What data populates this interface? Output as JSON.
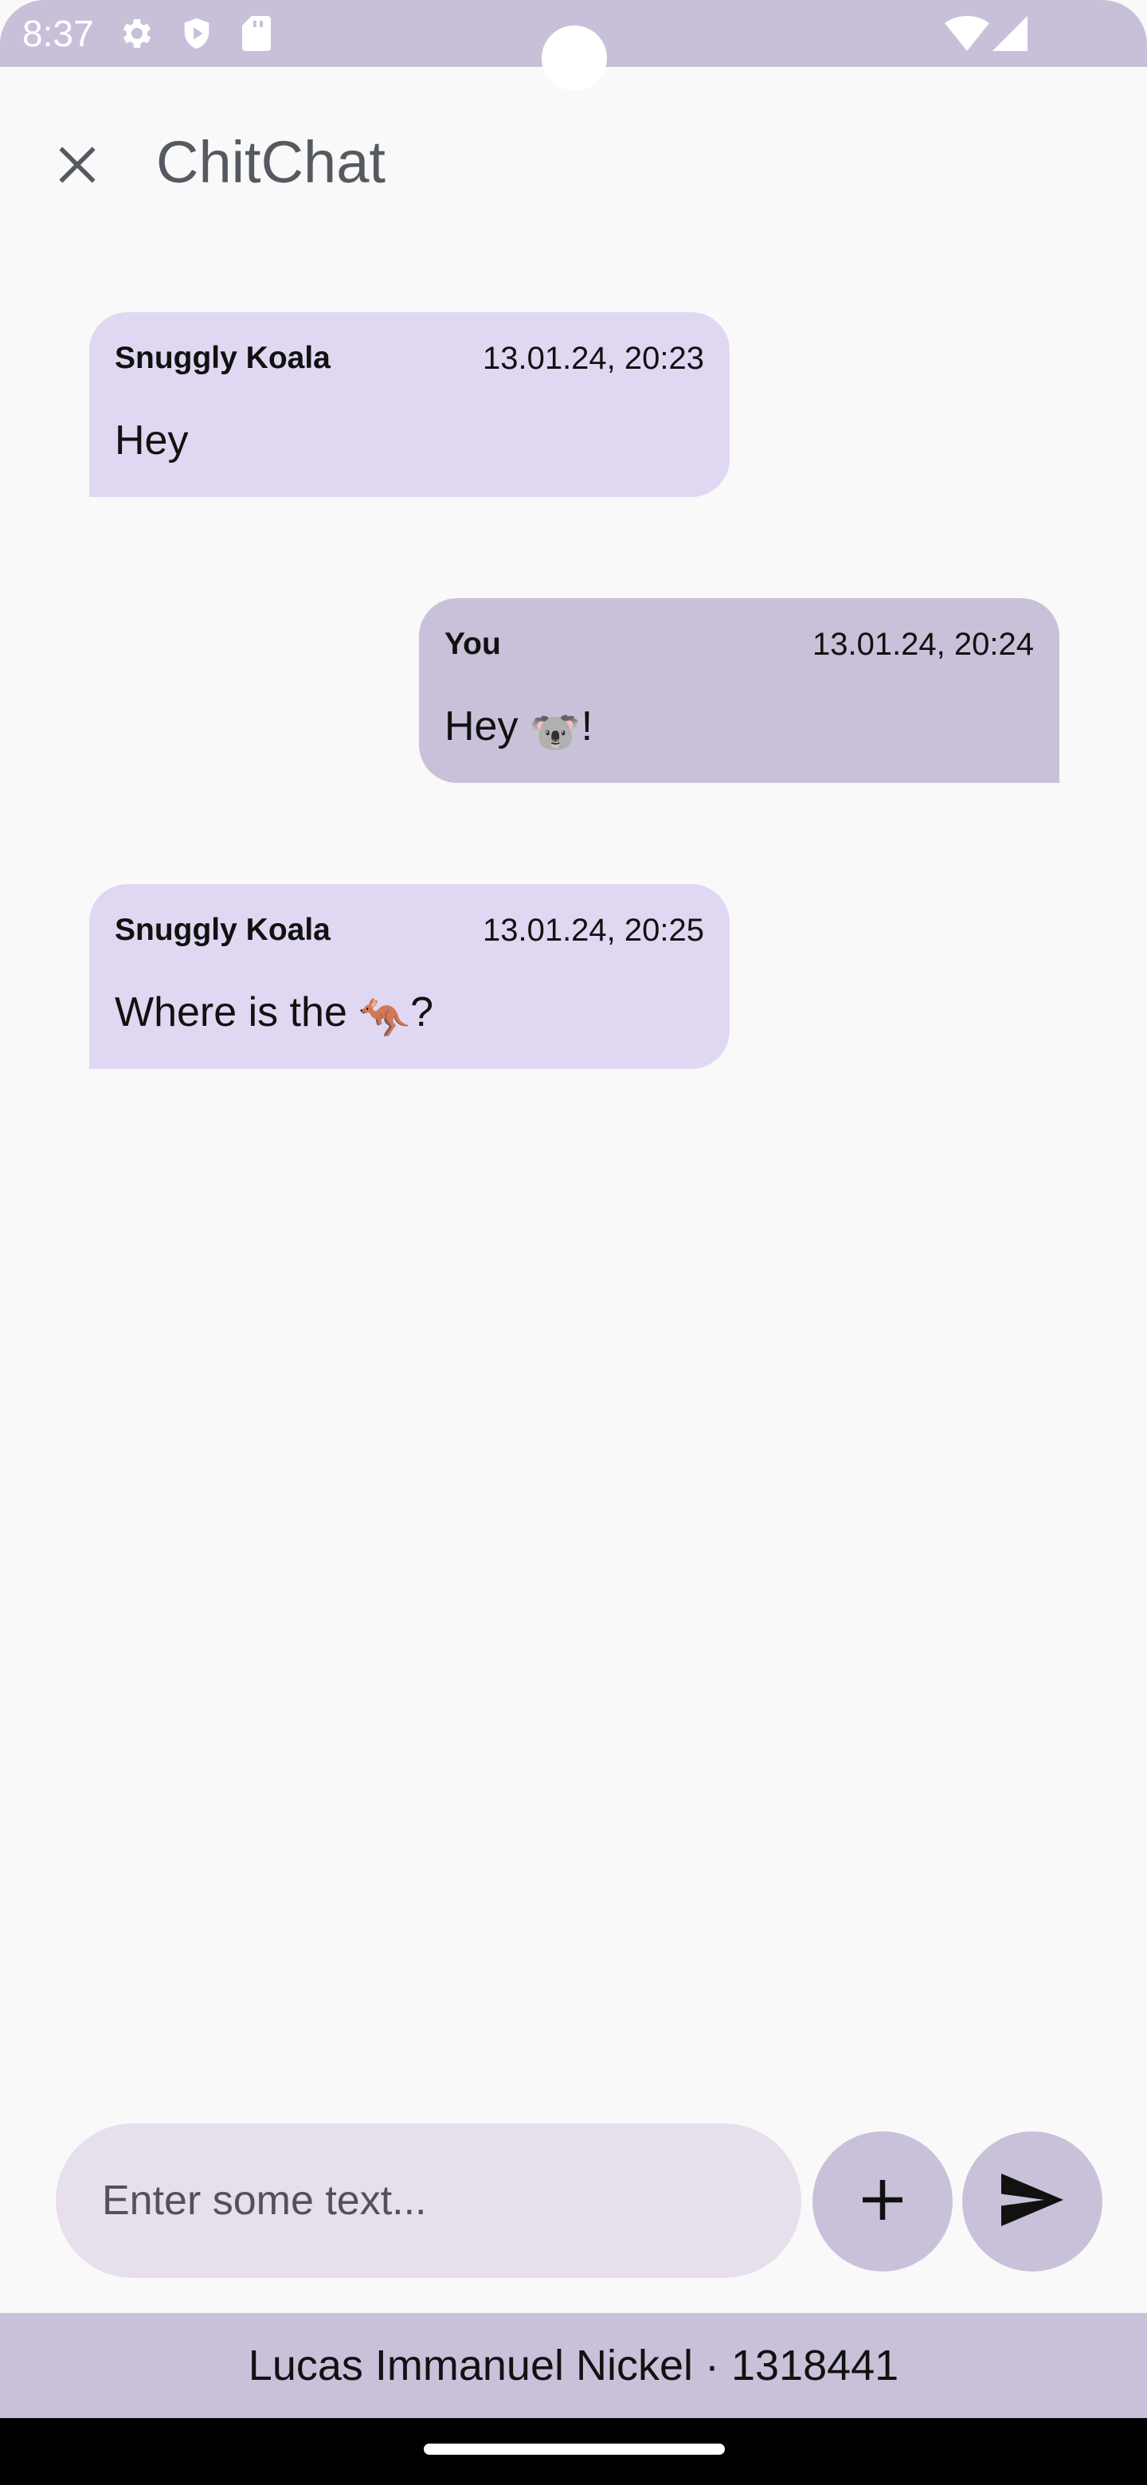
{
  "status_bar": {
    "time": "8:37",
    "icons_left": [
      "gear-icon",
      "shield-play-icon",
      "sd-card-icon"
    ],
    "icons_right": [
      "wifi-icon",
      "signal-icon"
    ]
  },
  "app_bar": {
    "title": "ChitChat",
    "close_icon": "close-icon"
  },
  "messages": [
    {
      "sender": "Snuggly Koala",
      "time": "13.01.24, 20:23",
      "text": "Hey",
      "emoji": "",
      "after": ""
    },
    {
      "sender": "You",
      "time": "13.01.24, 20:24",
      "text": "Hey ",
      "emoji": "🐨",
      "after": "!"
    },
    {
      "sender": "Snuggly Koala",
      "time": "13.01.24, 20:25",
      "text": "Where is the ",
      "emoji": "🦘",
      "after": "?"
    }
  ],
  "composer": {
    "placeholder": "Enter some text...",
    "value": "",
    "add_icon": "plus-icon",
    "send_icon": "send-icon"
  },
  "footer": {
    "text": "Lucas Immanuel Nickel · 1318441"
  },
  "colors": {
    "accent": "#c9c1d9",
    "incoming_bubble": "#e0d8f2",
    "outgoing_bubble": "#c9c1d9",
    "input_background": "#e7dfec",
    "background": "#f9f9fa"
  }
}
